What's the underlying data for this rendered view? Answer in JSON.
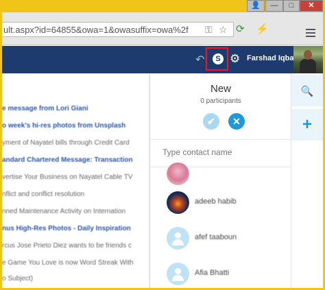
{
  "window": {
    "minimize_glyph": "—",
    "maximize_glyph": "□",
    "close_glyph": "✕",
    "person_glyph": "👤"
  },
  "browser": {
    "url": "ult.aspx?id=64855&owa=1&owasuffix=owa%2f",
    "icons": [
      "key-icon",
      "star-icon",
      "extension-icon",
      "lightning-icon",
      "menu-icon"
    ]
  },
  "header": {
    "user_name": "Farshad Iqbal",
    "icons": [
      "undo-icon",
      "skype-icon",
      "gear-icon"
    ]
  },
  "mail_list": [
    {
      "text": "e message from Lori Giani",
      "style": "bold"
    },
    {
      "text": "o week's hi-res photos from Unsplash",
      "style": "bold"
    },
    {
      "text": "yment of Nayatel bills through Credit Card",
      "style": "normal"
    },
    {
      "text": "andard Chartered Message: Transaction",
      "style": "bold"
    },
    {
      "text": "vertise Your Business on Nayatel Cable TV",
      "style": "normal"
    },
    {
      "text": "nflict and conflict resolution",
      "style": "normal"
    },
    {
      "text": "nned Maintenance Activity on Internation",
      "style": "normal"
    },
    {
      "text": "nus High-Res Photos - Daily Inspiration",
      "style": "bold"
    },
    {
      "text": "rcus Jose Prieto Diez wants to be friends c",
      "style": "normal"
    },
    {
      "text": "e Game You Love is now Word Streak With",
      "style": "normal"
    },
    {
      "text": "o Subject)",
      "style": "normal"
    }
  ],
  "panel": {
    "title": "New",
    "participants": "0 participants",
    "confirm_glyph": "✔",
    "cancel_glyph": "✕",
    "contact_placeholder": "Type contact name",
    "contacts": [
      {
        "name": "",
        "avatar": "photo1"
      },
      {
        "name": "adeeb habib",
        "avatar": "photo2"
      },
      {
        "name": "afef taaboun",
        "avatar": "default"
      },
      {
        "name": "Afia Bhatti",
        "avatar": "default"
      }
    ]
  },
  "rail": {
    "search_glyph": "🔍",
    "add_glyph": "+"
  },
  "colors": {
    "frame": "#f0c419",
    "app_header": "#1d3b6e",
    "accent": "#1e9ad6",
    "highlight_box": "#e21d25",
    "unread_link": "#2c57a8"
  }
}
